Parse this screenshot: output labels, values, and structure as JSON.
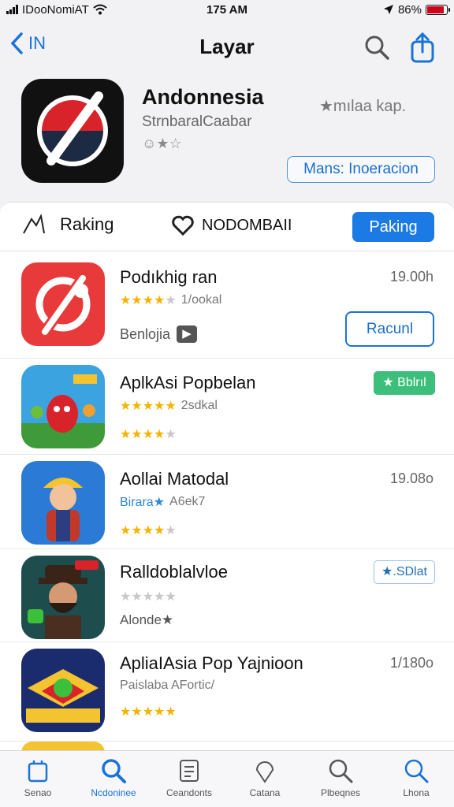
{
  "status_bar": {
    "carrier": "IDooNomiAT",
    "time": "175 AM",
    "battery": "86%",
    "battery_level": 0.86
  },
  "nav": {
    "back_label": "IN",
    "title": "Layar",
    "search_icon": "search-icon",
    "share_icon": "share-icon"
  },
  "hero": {
    "app_name": "Andonnesia",
    "subtitle": "StrnbaralCaabar",
    "rating_text": "☺★☆",
    "note": "★mılaa kap.",
    "button_label": "Mans: Inoeracion"
  },
  "segments": {
    "a_label": "Raking",
    "b_label": "NODOMBAII",
    "c_label": "Paking"
  },
  "apps": [
    {
      "name": "Podıkhig ran",
      "rating": 3.5,
      "rating_text": "1/ookal",
      "tag": "Benlojia",
      "meta": "19.00h",
      "button": "Racunl"
    },
    {
      "name": "AplkAsi Popbelan",
      "rating": 4.5,
      "rating_text": "2sdkal",
      "rating2": 4,
      "button": "★ Bblrıl"
    },
    {
      "name": "Aollai Matodal",
      "blue_label": "Birara★",
      "rating_text": "A6ek7",
      "rating2": 4,
      "meta": "19.08o"
    },
    {
      "name": "Ralldoblalvloe",
      "rating": 0,
      "tag": "Alonde★",
      "button": "★.SDlat"
    },
    {
      "name": "ApliaIAsia Pop Yajnioon",
      "sub_text": "Paislaba AFortic/",
      "rating2": 5,
      "meta": "1/180o"
    }
  ],
  "tabbar": [
    {
      "label": "Senao",
      "icon": "home-icon",
      "active": false
    },
    {
      "label": "Ncdoninee",
      "icon": "search-icon",
      "active": true
    },
    {
      "label": "Ceandonts",
      "icon": "list-icon",
      "active": false
    },
    {
      "label": "Catana",
      "icon": "pin-icon",
      "active": false
    },
    {
      "label": "Plbeqnes",
      "icon": "search-icon",
      "active": false
    },
    {
      "label": "Lhona",
      "icon": "search-icon",
      "active": false
    }
  ],
  "colors": {
    "accent": "#1b7ae3",
    "green": "#3cbf7a",
    "star": "#f5b301"
  }
}
